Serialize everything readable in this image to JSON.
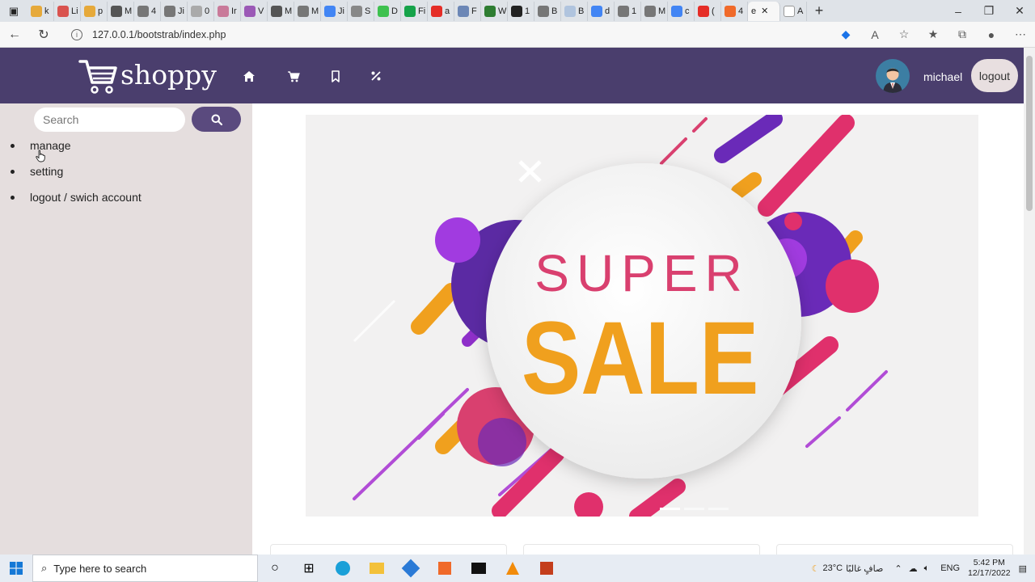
{
  "browser": {
    "tabs": [
      "k",
      "Li",
      "p",
      "M",
      "4",
      "Ji",
      "0",
      "Ir",
      "V",
      "M",
      "M",
      "Ji",
      "S",
      "D",
      "Fi",
      "a",
      "F",
      "W",
      "1",
      "B",
      "B",
      "d",
      "1",
      "M",
      "c",
      "(",
      "4",
      "e",
      "A"
    ],
    "url": "127.0.0.1/bootstrab/index.php"
  },
  "header": {
    "logo_text": "shoppy",
    "username": "michael",
    "logout_label": "logout",
    "nav_icons": [
      "home-icon",
      "cart-icon",
      "bookmark-icon",
      "percent-icon"
    ]
  },
  "sidebar": {
    "search_placeholder": "Search",
    "items": [
      {
        "label": "manage"
      },
      {
        "label": "setting"
      },
      {
        "label": "logout / swich account"
      }
    ]
  },
  "banner": {
    "line1": "SUPER",
    "line2": "SALE",
    "slides": 3,
    "active_slide": 1
  },
  "taskbar": {
    "search_placeholder": "Type here to search",
    "weather": "23°C",
    "weather_text": "صافٍ غالبًا",
    "language": "ENG",
    "time": "5:42 PM",
    "date": "12/17/2022"
  },
  "colors": {
    "header_bg": "#4a3e6d",
    "sidebar_bg": "#e5dede",
    "search_button": "#5a4a7e",
    "sale_pink": "#d9406f",
    "sale_orange": "#f0a01e",
    "accent_purple": "#7b2fbe"
  }
}
